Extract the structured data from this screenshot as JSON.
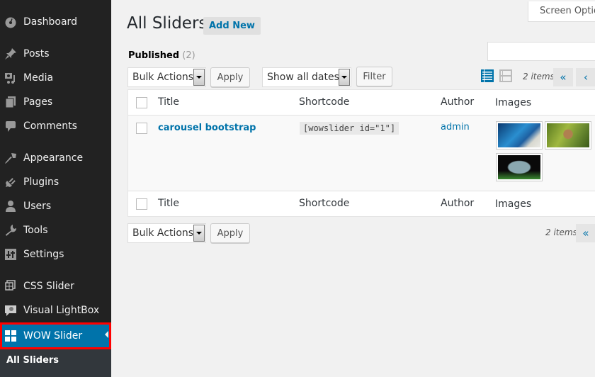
{
  "sidebar": {
    "items": [
      {
        "label": "Dashboard",
        "icon": "dashboard-icon"
      },
      {
        "label": "Posts",
        "icon": "pin-icon"
      },
      {
        "label": "Media",
        "icon": "media-icon"
      },
      {
        "label": "Pages",
        "icon": "pages-icon"
      },
      {
        "label": "Comments",
        "icon": "comment-icon"
      },
      {
        "label": "Appearance",
        "icon": "brush-icon"
      },
      {
        "label": "Plugins",
        "icon": "plug-icon"
      },
      {
        "label": "Users",
        "icon": "user-icon"
      },
      {
        "label": "Tools",
        "icon": "wrench-icon"
      },
      {
        "label": "Settings",
        "icon": "settings-icon"
      },
      {
        "label": "CSS Slider",
        "icon": "css-slider-icon"
      },
      {
        "label": "Visual LightBox",
        "icon": "lightbox-icon"
      },
      {
        "label": "WOW Slider",
        "icon": "grid-icon",
        "active": true
      }
    ],
    "submenu": {
      "active_item": "All Sliders"
    },
    "active_color": "#0073aa",
    "highlight_color": "#ff0000"
  },
  "header": {
    "screen_options": "Screen Options",
    "title": "All Sliders",
    "add_new": "Add New"
  },
  "filters": {
    "published_label": "Published",
    "published_count": "(2)",
    "bulk_actions": "Bulk Actions",
    "apply": "Apply",
    "dates": "Show all dates",
    "filter": "Filter",
    "search_value": ""
  },
  "pagination": {
    "items_count": "2 items",
    "first": "«",
    "prev": "‹"
  },
  "table": {
    "columns": [
      "Title",
      "Shortcode",
      "Author",
      "Images"
    ],
    "rows": [
      {
        "title": "carousel bootstrap",
        "shortcode": "[wowslider id=\"1\"]",
        "author": "admin",
        "images": [
          "blue-butterfly-thumbnail",
          "brown-butterfly-thumbnail",
          "striped-butterfly-thumbnail"
        ]
      }
    ]
  },
  "bottom": {
    "bulk_actions": "Bulk Actions",
    "apply": "Apply",
    "items_count": "2 items",
    "first": "«"
  }
}
